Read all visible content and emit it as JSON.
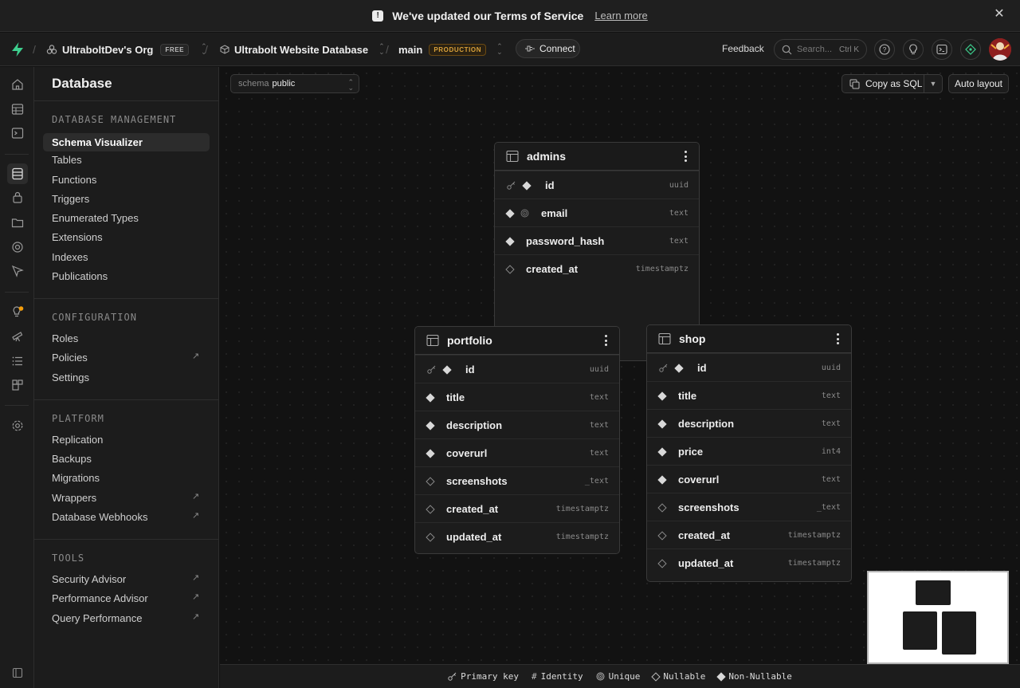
{
  "banner": {
    "message": "We've updated our Terms of Service",
    "link": "Learn more"
  },
  "topnav": {
    "org": "UltraboltDev's Org",
    "org_badge": "FREE",
    "project": "Ultrabolt Website Database",
    "branch": "main",
    "branch_badge": "PRODUCTION",
    "connect": "Connect",
    "feedback": "Feedback",
    "search_placeholder": "Search...",
    "search_shortcut": "Ctrl K"
  },
  "sidebar": {
    "title": "Database",
    "sections": [
      {
        "heading": "DATABASE MANAGEMENT",
        "items": [
          "Schema Visualizer",
          "Tables",
          "Functions",
          "Triggers",
          "Enumerated Types",
          "Extensions",
          "Indexes",
          "Publications"
        ]
      },
      {
        "heading": "CONFIGURATION",
        "items": [
          "Roles",
          "Policies",
          "Settings"
        ]
      },
      {
        "heading": "PLATFORM",
        "items": [
          "Replication",
          "Backups",
          "Migrations",
          "Wrappers",
          "Database Webhooks"
        ]
      },
      {
        "heading": "TOOLS",
        "items": [
          "Security Advisor",
          "Performance Advisor",
          "Query Performance"
        ]
      }
    ],
    "active_item": "Schema Visualizer"
  },
  "toolbar": {
    "schema_label": "schema",
    "schema_value": "public",
    "copy_sql": "Copy as SQL",
    "auto_layout": "Auto layout"
  },
  "tables": {
    "admins": {
      "name": "admins",
      "columns": [
        {
          "name": "id",
          "type": "uuid"
        },
        {
          "name": "email",
          "type": "text"
        },
        {
          "name": "password_hash",
          "type": "text"
        },
        {
          "name": "created_at",
          "type": "timestamptz"
        }
      ]
    },
    "portfolio": {
      "name": "portfolio",
      "columns": [
        {
          "name": "id",
          "type": "uuid"
        },
        {
          "name": "title",
          "type": "text"
        },
        {
          "name": "description",
          "type": "text"
        },
        {
          "name": "coverurl",
          "type": "text"
        },
        {
          "name": "screenshots",
          "type": "_text"
        },
        {
          "name": "created_at",
          "type": "timestamptz"
        },
        {
          "name": "updated_at",
          "type": "timestamptz"
        }
      ]
    },
    "shop": {
      "name": "shop",
      "columns": [
        {
          "name": "id",
          "type": "uuid"
        },
        {
          "name": "title",
          "type": "text"
        },
        {
          "name": "description",
          "type": "text"
        },
        {
          "name": "price",
          "type": "int4"
        },
        {
          "name": "coverurl",
          "type": "text"
        },
        {
          "name": "screenshots",
          "type": "_text"
        },
        {
          "name": "created_at",
          "type": "timestamptz"
        },
        {
          "name": "updated_at",
          "type": "timestamptz"
        }
      ]
    }
  },
  "legend": [
    "Primary key",
    "Identity",
    "Unique",
    "Nullable",
    "Non-Nullable"
  ]
}
